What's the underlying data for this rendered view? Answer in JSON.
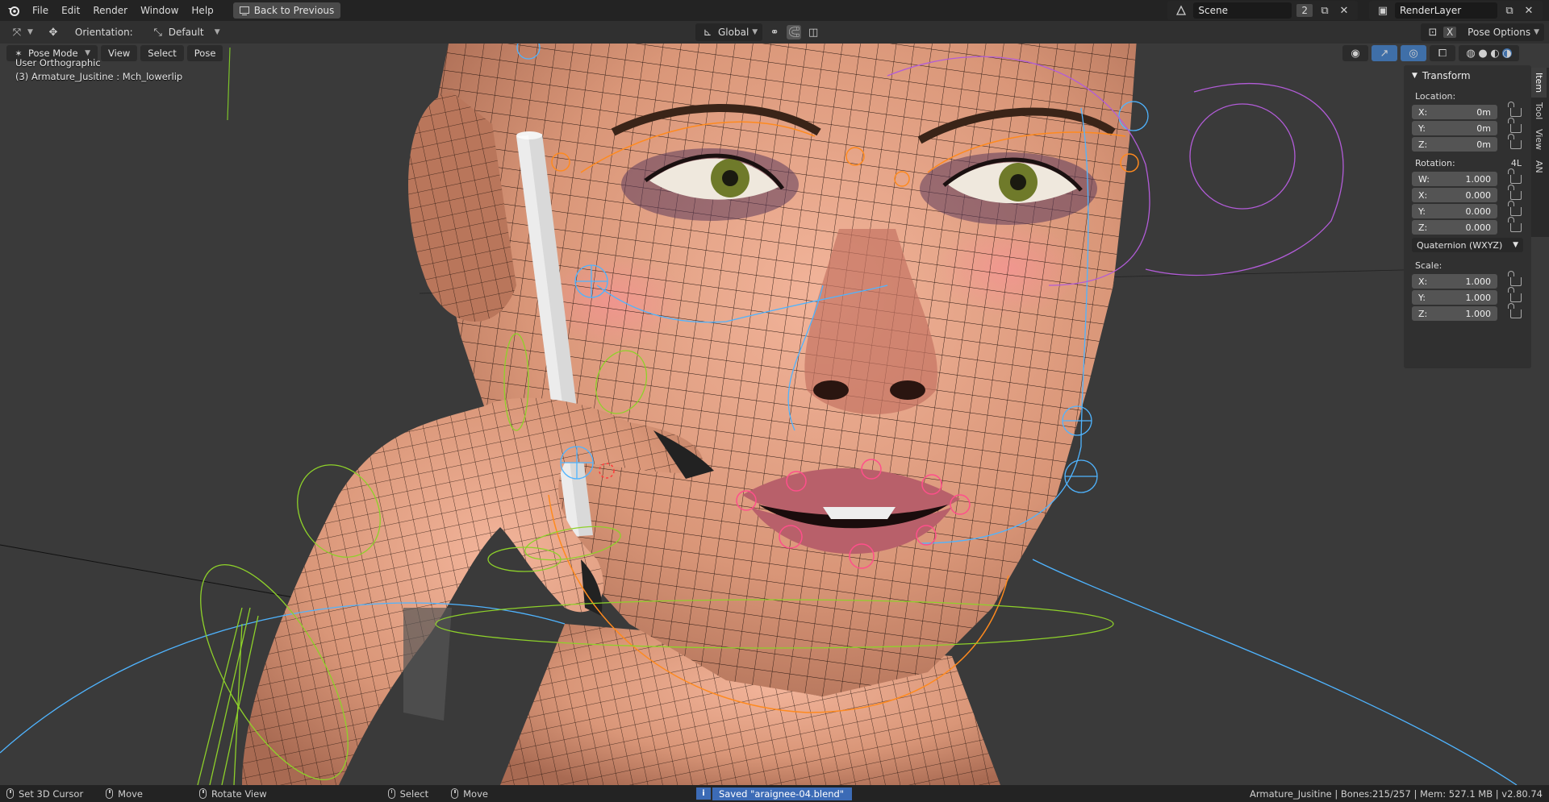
{
  "app": {
    "menus": [
      "File",
      "Edit",
      "Render",
      "Window",
      "Help"
    ],
    "back_button": "Back to Previous",
    "scene_name": "Scene",
    "scene_count": "2",
    "render_layer": "RenderLayer"
  },
  "toolbar": {
    "orientation_label": "Orientation:",
    "orientation_value": "Default",
    "transform_space": "Global",
    "pose_options": "Pose Options"
  },
  "viewport": {
    "mode": "Pose Mode",
    "menus": [
      "View",
      "Select",
      "Pose"
    ],
    "view_name": "User Orthographic",
    "active_object": "(3) Armature_Jusitine : Mch_lowerlip"
  },
  "transform_panel": {
    "title": "Transform",
    "location_label": "Location:",
    "location": [
      {
        "axis": "X:",
        "value": "0m"
      },
      {
        "axis": "Y:",
        "value": "0m"
      },
      {
        "axis": "Z:",
        "value": "0m"
      }
    ],
    "rotation_label": "Rotation:",
    "rotation_lock": "4L",
    "rotation": [
      {
        "axis": "W:",
        "value": "1.000"
      },
      {
        "axis": "X:",
        "value": "0.000"
      },
      {
        "axis": "Y:",
        "value": "0.000"
      },
      {
        "axis": "Z:",
        "value": "0.000"
      }
    ],
    "rotation_mode": "Quaternion (WXYZ)",
    "scale_label": "Scale:",
    "scale": [
      {
        "axis": "X:",
        "value": "1.000"
      },
      {
        "axis": "Y:",
        "value": "1.000"
      },
      {
        "axis": "Z:",
        "value": "1.000"
      }
    ]
  },
  "sidebar_tabs": [
    "Item",
    "Tool",
    "View",
    "AN"
  ],
  "statusbar": {
    "set_cursor": "Set 3D Cursor",
    "move": "Move",
    "rotate_view": "Rotate View",
    "select": "Select",
    "move2": "Move",
    "message": "Saved \"araignee-04.blend\"",
    "stats": "Armature_Jusitine | Bones:215/257 | Mem: 527.1 MB | v2.80.74"
  },
  "colors": {
    "topbar": "#232323",
    "viewport_bg": "#3a3a3a",
    "skin": "#e0a384",
    "bone_orange": "#ff8a1e",
    "bone_blue": "#4fb4ff",
    "bone_green": "#8ed12a",
    "bone_purple": "#b25cd8",
    "bone_pink": "#ff4f8b",
    "status_info": "#3c6bb6"
  }
}
